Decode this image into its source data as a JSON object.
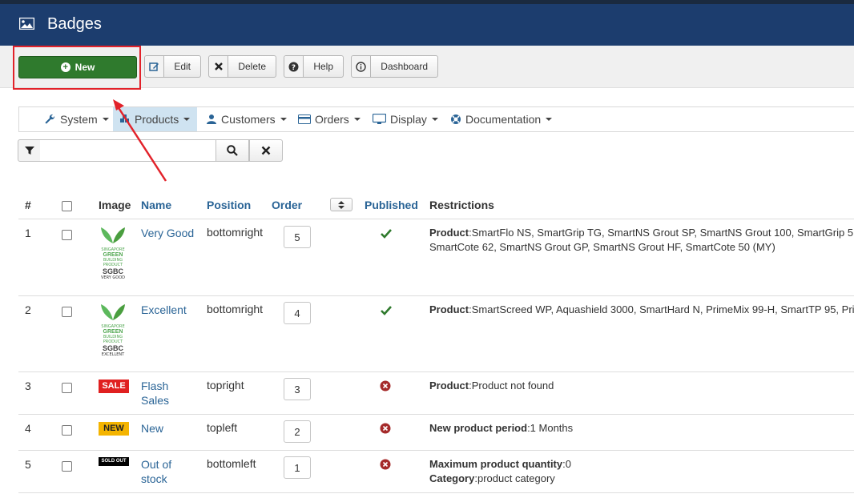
{
  "header": {
    "title": "Badges"
  },
  "toolbar": {
    "new_label": "New",
    "edit_label": "Edit",
    "delete_label": "Delete",
    "help_label": "Help",
    "dashboard_label": "Dashboard"
  },
  "menu": {
    "items": [
      {
        "label": "System"
      },
      {
        "label": "Products"
      },
      {
        "label": "Customers"
      },
      {
        "label": "Orders"
      },
      {
        "label": "Display"
      },
      {
        "label": "Documentation"
      }
    ],
    "active": "Products"
  },
  "search": {
    "value": ""
  },
  "table": {
    "headers": {
      "num": "#",
      "image": "Image",
      "name": "Name",
      "position": "Position",
      "order": "Order",
      "published": "Published",
      "restrictions": "Restrictions"
    },
    "rows": [
      {
        "num": "1",
        "name": "Very Good",
        "position": "bottomright",
        "order": "5",
        "published": true,
        "image": "sgbc-very-good",
        "restr": [
          {
            "label": "Product",
            "text": ":SmartFlo NS, SmartGrip TG, SmartNS Grout SP, SmartNS Grout 100, SmartGrip 5"
          },
          {
            "label": "",
            "text": "SmartCote 62, SmartNS Grout GP, SmartNS Grout HF, SmartCote 50 (MY)"
          }
        ]
      },
      {
        "num": "2",
        "name": "Excellent",
        "position": "bottomright",
        "order": "4",
        "published": true,
        "image": "sgbc-excellent",
        "restr": [
          {
            "label": "Product",
            "text": ":SmartScreed WP, Aquashield 3000, SmartHard N, PrimeMix 99-H, SmartTP 95, Pri"
          }
        ]
      },
      {
        "num": "3",
        "name_line1": "Flash",
        "name_line2": "Sales",
        "position": "topright",
        "order": "3",
        "published": false,
        "image": "SALE",
        "restr": [
          {
            "label": "Product",
            "text": ":Product not found"
          }
        ]
      },
      {
        "num": "4",
        "name": "New",
        "position": "topleft",
        "order": "2",
        "published": false,
        "image": "NEW",
        "restr": [
          {
            "label": "New product period",
            "text": ":1 Months"
          }
        ]
      },
      {
        "num": "5",
        "name_line1": "Out of",
        "name_line2": "stock",
        "position": "bottomleft",
        "order": "1",
        "published": false,
        "image": "SOLD OUT",
        "restr": [
          {
            "label": "Maximum product quantity",
            "text": ":0"
          },
          {
            "label": "Category",
            "text": ":product category"
          }
        ]
      }
    ]
  },
  "sgbc": {
    "line1": "SINGAPORE",
    "line2": "GREEN",
    "line3": "BUILDING",
    "line4": "PRODUCT",
    "line5": "SGBC",
    "very_good": "VERY GOOD",
    "excellent": "EXCELLENT"
  },
  "colors": {
    "header_bg": "#1c3d6e",
    "new_button": "#2f7a2d",
    "highlight": "#e2222a",
    "link": "#2a6496",
    "published_yes": "#2f7a2d",
    "published_no": "#a52a2a",
    "menu_active": "#cfe3f1"
  }
}
